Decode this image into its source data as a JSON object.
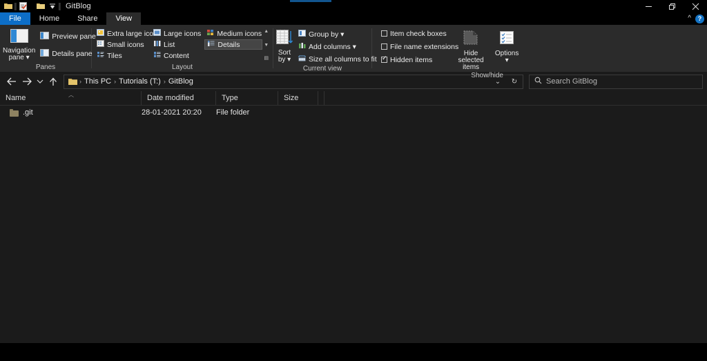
{
  "window": {
    "title": "GitBlog",
    "quick_access": [
      {
        "name": "folder-icon",
        "label": "Folder"
      },
      {
        "name": "properties-icon",
        "label": "Properties"
      },
      {
        "name": "new-folder-icon",
        "label": "New folder"
      },
      {
        "name": "customize-qat-icon",
        "label": "Customize Quick Access Toolbar"
      }
    ],
    "controls": {
      "minimize": "Minimize",
      "restore": "Restore Down",
      "close": "Close",
      "collapse_ribbon": "^",
      "help": "?"
    }
  },
  "tabs": [
    {
      "label": "File",
      "state": "file"
    },
    {
      "label": "Home",
      "state": "normal"
    },
    {
      "label": "Share",
      "state": "normal"
    },
    {
      "label": "View",
      "state": "active"
    }
  ],
  "ribbon": {
    "panes": {
      "label": "Panes",
      "navigation_pane": "Navigation\npane",
      "navigation_pane_line1": "Navigation",
      "navigation_pane_line2": "pane",
      "preview_pane": "Preview pane",
      "details_pane": "Details pane"
    },
    "layout": {
      "label": "Layout",
      "items": [
        {
          "label": "Extra large icons",
          "selected": false
        },
        {
          "label": "Large icons",
          "selected": false
        },
        {
          "label": "Medium icons",
          "selected": false
        },
        {
          "label": "Small icons",
          "selected": false
        },
        {
          "label": "List",
          "selected": false
        },
        {
          "label": "Details",
          "selected": true
        },
        {
          "label": "Tiles",
          "selected": false
        },
        {
          "label": "Content",
          "selected": false
        }
      ]
    },
    "current_view": {
      "label": "Current view",
      "sort_by_line1": "Sort",
      "sort_by_line2": "by",
      "group_by": "Group by",
      "add_columns": "Add columns",
      "size_all_columns": "Size all columns to fit"
    },
    "show_hide": {
      "label": "Show/hide",
      "item_check_boxes": {
        "label": "Item check boxes",
        "checked": false
      },
      "file_name_extensions": {
        "label": "File name extensions",
        "checked": false
      },
      "hidden_items": {
        "label": "Hidden items",
        "checked": true
      },
      "hide_selected_line1": "Hide selected",
      "hide_selected_line2": "items",
      "options_label": "Options"
    }
  },
  "address": {
    "back": "Back",
    "forward": "Forward",
    "recent": "Recent locations",
    "up": "Up",
    "breadcrumbs": [
      "This PC",
      "Tutorials (T:)",
      "GitBlog"
    ],
    "separator": "›",
    "dropdown": "⌄",
    "refresh": "↻"
  },
  "search": {
    "placeholder": "Search GitBlog",
    "icon": "search-icon"
  },
  "columns": [
    {
      "label": "Name",
      "sorted": "asc"
    },
    {
      "label": "Date modified",
      "sorted": ""
    },
    {
      "label": "Type",
      "sorted": ""
    },
    {
      "label": "Size",
      "sorted": ""
    }
  ],
  "files": [
    {
      "name": ".git",
      "date_modified": "28-01-2021 20:20",
      "type": "File folder",
      "size": "",
      "hidden": true
    }
  ],
  "colors": {
    "accent": "#0d6ec7",
    "ribbon_bg": "#2b2b2b",
    "content_bg": "#1b1b1b",
    "titlebar_bg": "#000000",
    "folder": "#e3c36a",
    "folder_hidden": "#8e8261"
  }
}
